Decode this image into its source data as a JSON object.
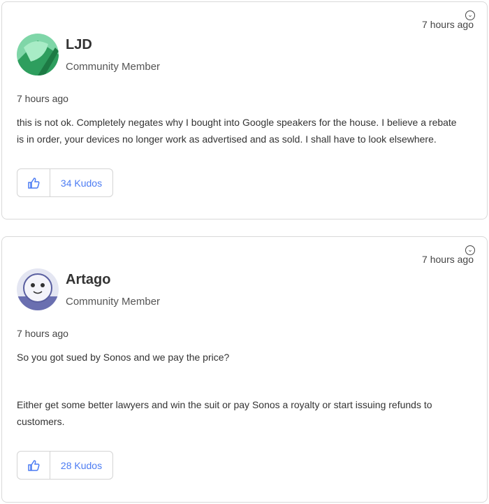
{
  "posts": [
    {
      "author": "LJD",
      "role": "Community Member",
      "header_time": "7 hours ago",
      "date": "7 hours ago",
      "paragraphs": [
        "this is not ok. Completely negates why  I bought into Google speakers for the house. I believe a rebate is in order, your devices no longer work as advertised and as sold. I shall have to look elsewhere."
      ],
      "kudos": "34 Kudos",
      "avatar_icon": "green-abstract-avatar"
    },
    {
      "author": "Artago",
      "role": "Community Member",
      "header_time": "7 hours ago",
      "date": "7 hours ago",
      "paragraphs": [
        "So you got sued by Sonos and we pay the price?",
        "Either get some better lawyers and win the suit or pay Sonos a royalty or start issuing refunds to customers."
      ],
      "kudos": "28 Kudos",
      "avatar_icon": "smiley-face-avatar"
    }
  ],
  "colors": {
    "accent": "#4c7cf3",
    "border": "#d9d9d9"
  }
}
